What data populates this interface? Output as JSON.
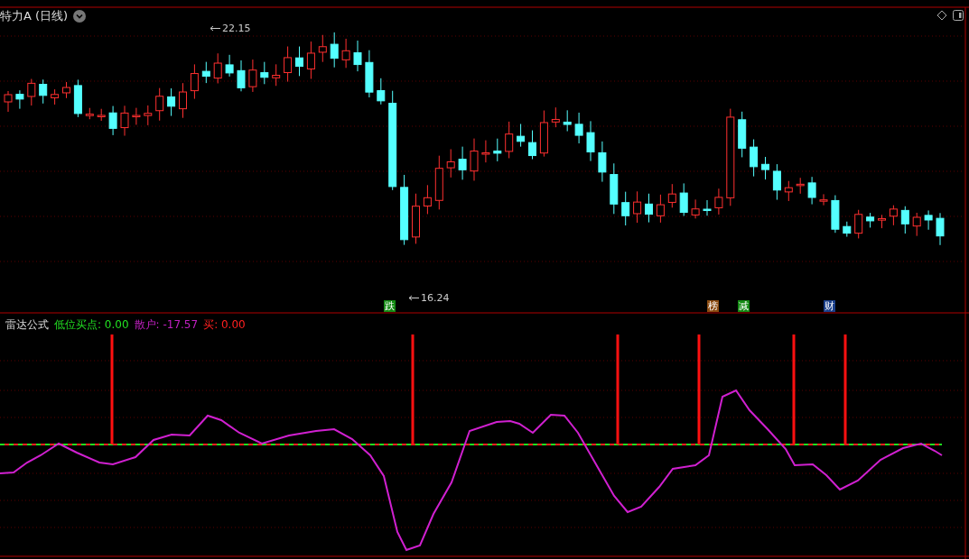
{
  "chart": {
    "title": "特力A (日线)",
    "price_marks": [
      {
        "text": "22.15"
      },
      {
        "text": "16.24"
      }
    ],
    "events": [
      {
        "text": "跌",
        "color": "#138a13"
      },
      {
        "text": "榜",
        "color": "#8a4a10"
      },
      {
        "text": "减",
        "color": "#138a13"
      },
      {
        "text": "财",
        "color": "#1a3f8a"
      }
    ]
  },
  "indicator": {
    "name": "雷达公式",
    "legend": [
      {
        "label": "低位买点:",
        "value": "0.00",
        "color": "#22e022"
      },
      {
        "label": "散户:",
        "value": "-17.57",
        "color": "#c020c0"
      },
      {
        "label": "买:",
        "value": "0.00",
        "color": "#ff2020"
      }
    ]
  }
}
